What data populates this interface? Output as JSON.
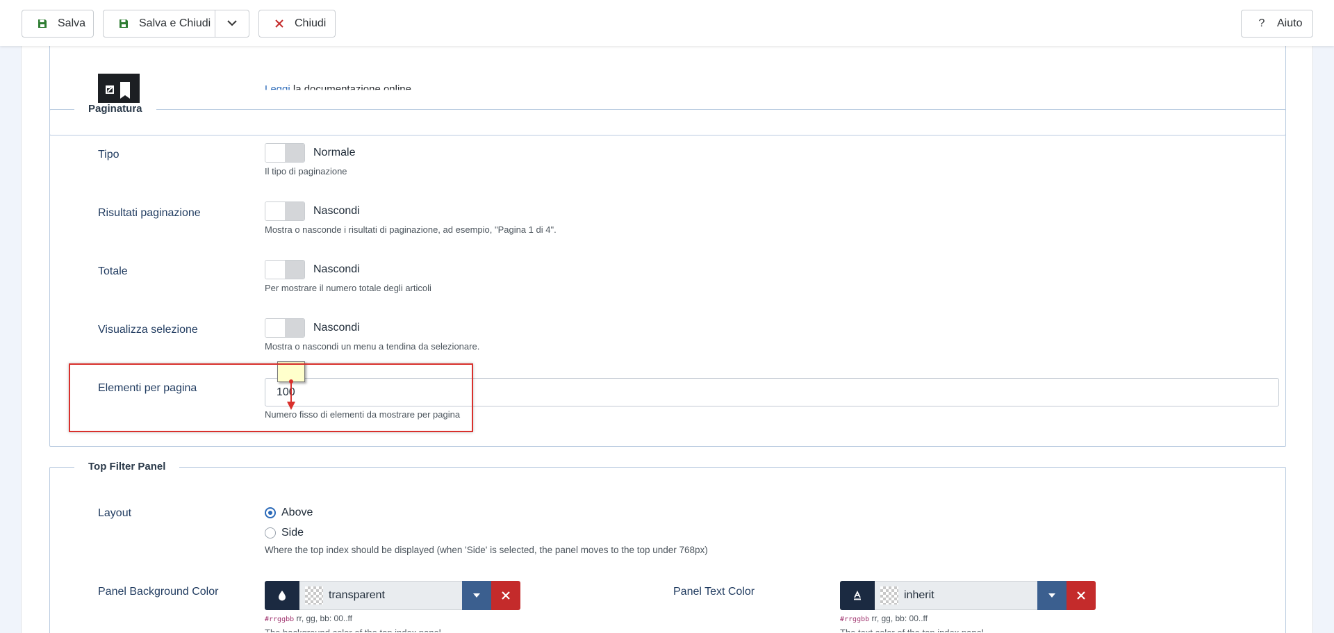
{
  "toolbar": {
    "save_label": "Salva",
    "save_close_label": "Salva e Chiudi",
    "close_label": "Chiudi",
    "help_label": "Aiuto",
    "help_glyph": "?"
  },
  "doc": {
    "link_text": "Leggi",
    "link_rest": " la documentazione online."
  },
  "pagination": {
    "legend": "Paginatura",
    "fields": [
      {
        "label": "Tipo",
        "value": "Normale",
        "description": "Il tipo di paginazione"
      },
      {
        "label": "Risultati paginazione",
        "value": "Nascondi",
        "description": "Mostra o nasconde i risultati di paginazione, ad esempio, \"Pagina 1 di 4\"."
      },
      {
        "label": "Totale",
        "value": "Nascondi",
        "description": "Per mostrare il numero totale degli articoli"
      },
      {
        "label": "Visualizza selezione",
        "value": "Nascondi",
        "description": "Mostra o nascondi un menu a tendina da selezionare."
      }
    ],
    "items_per_page": {
      "label": "Elementi per pagina",
      "value": "100",
      "description": "Numero fisso di elementi da mostrare per pagina"
    }
  },
  "top_filter": {
    "legend": "Top Filter Panel",
    "layout": {
      "label": "Layout",
      "options": [
        "Above",
        "Side"
      ],
      "selected": "Above",
      "description": "Where the top index should be displayed (when 'Side' is selected, the panel moves to the top under 768px)"
    },
    "bg_color": {
      "label": "Panel Background Color",
      "value": "transparent",
      "hint_code": "#rrggbb",
      "hint_text": " rr, gg, bb: 00..ff",
      "more": "The background color of the top index panel",
      "icon": "droplet-icon"
    },
    "text_color": {
      "label": "Panel Text Color",
      "value": "inherit",
      "hint_code": "#rrggbb",
      "hint_text": " rr, gg, bb: 00..ff",
      "more": "The text color of the top index panel",
      "icon": "font-color-icon"
    }
  },
  "colors": {
    "accent": "#2a69b8",
    "danger": "#c42b2b",
    "dark": "#1b2a41",
    "highlight": "#d9302c"
  }
}
